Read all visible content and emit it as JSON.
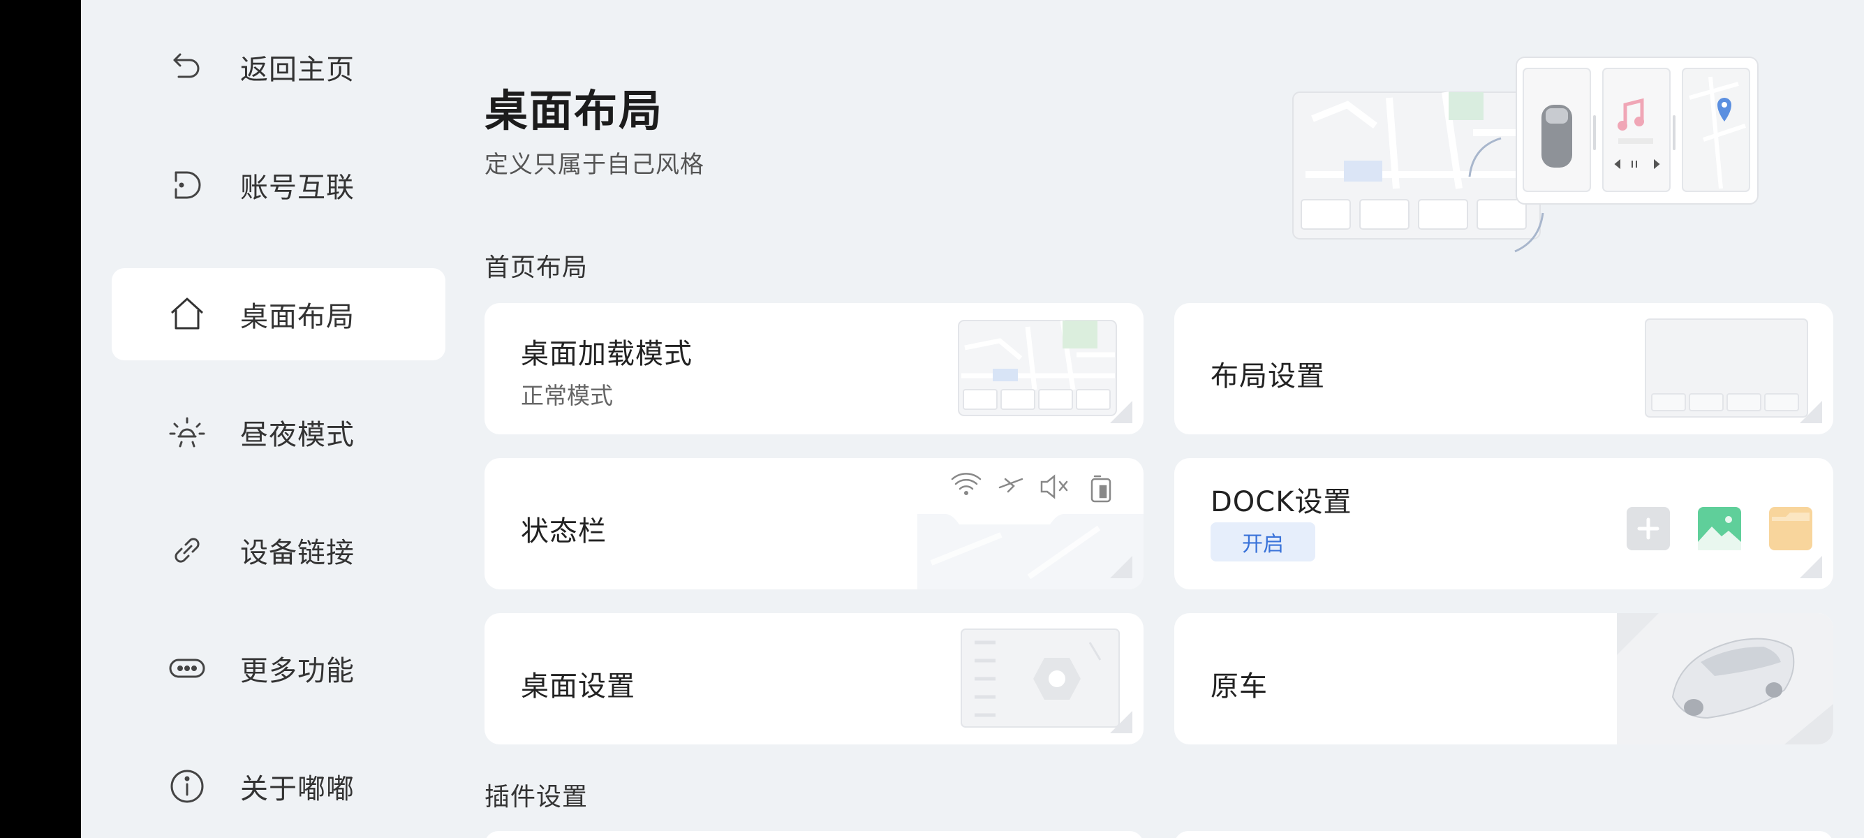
{
  "sidebar": {
    "items": [
      {
        "label": "返回主页",
        "icon": "back-arrow-icon"
      },
      {
        "label": "账号互联",
        "icon": "account-link-icon"
      },
      {
        "label": "桌面布局",
        "icon": "home-icon",
        "active": true
      },
      {
        "label": "昼夜模式",
        "icon": "sun-icon"
      },
      {
        "label": "设备链接",
        "icon": "link-icon"
      },
      {
        "label": "更多功能",
        "icon": "more-dots-icon"
      },
      {
        "label": "关于嘟嘟",
        "icon": "info-icon"
      }
    ]
  },
  "page": {
    "title": "桌面布局",
    "subtitle": "定义只属于自己风格"
  },
  "sections": {
    "home_layout": "首页布局",
    "plugin_settings": "插件设置"
  },
  "cards": {
    "desktop_load_mode": {
      "title": "桌面加载模式",
      "value": "正常模式"
    },
    "layout_settings": {
      "title": "布局设置"
    },
    "status_bar": {
      "title": "状态栏"
    },
    "dock_settings": {
      "title": "DOCK设置",
      "badge": "开启"
    },
    "desktop_settings": {
      "title": "桌面设置"
    },
    "original_car": {
      "title": "原车"
    }
  },
  "colors": {
    "background": "#eff2f5",
    "card": "#ffffff",
    "accent": "#3a73d9",
    "badge_bg": "#e6eefb"
  }
}
